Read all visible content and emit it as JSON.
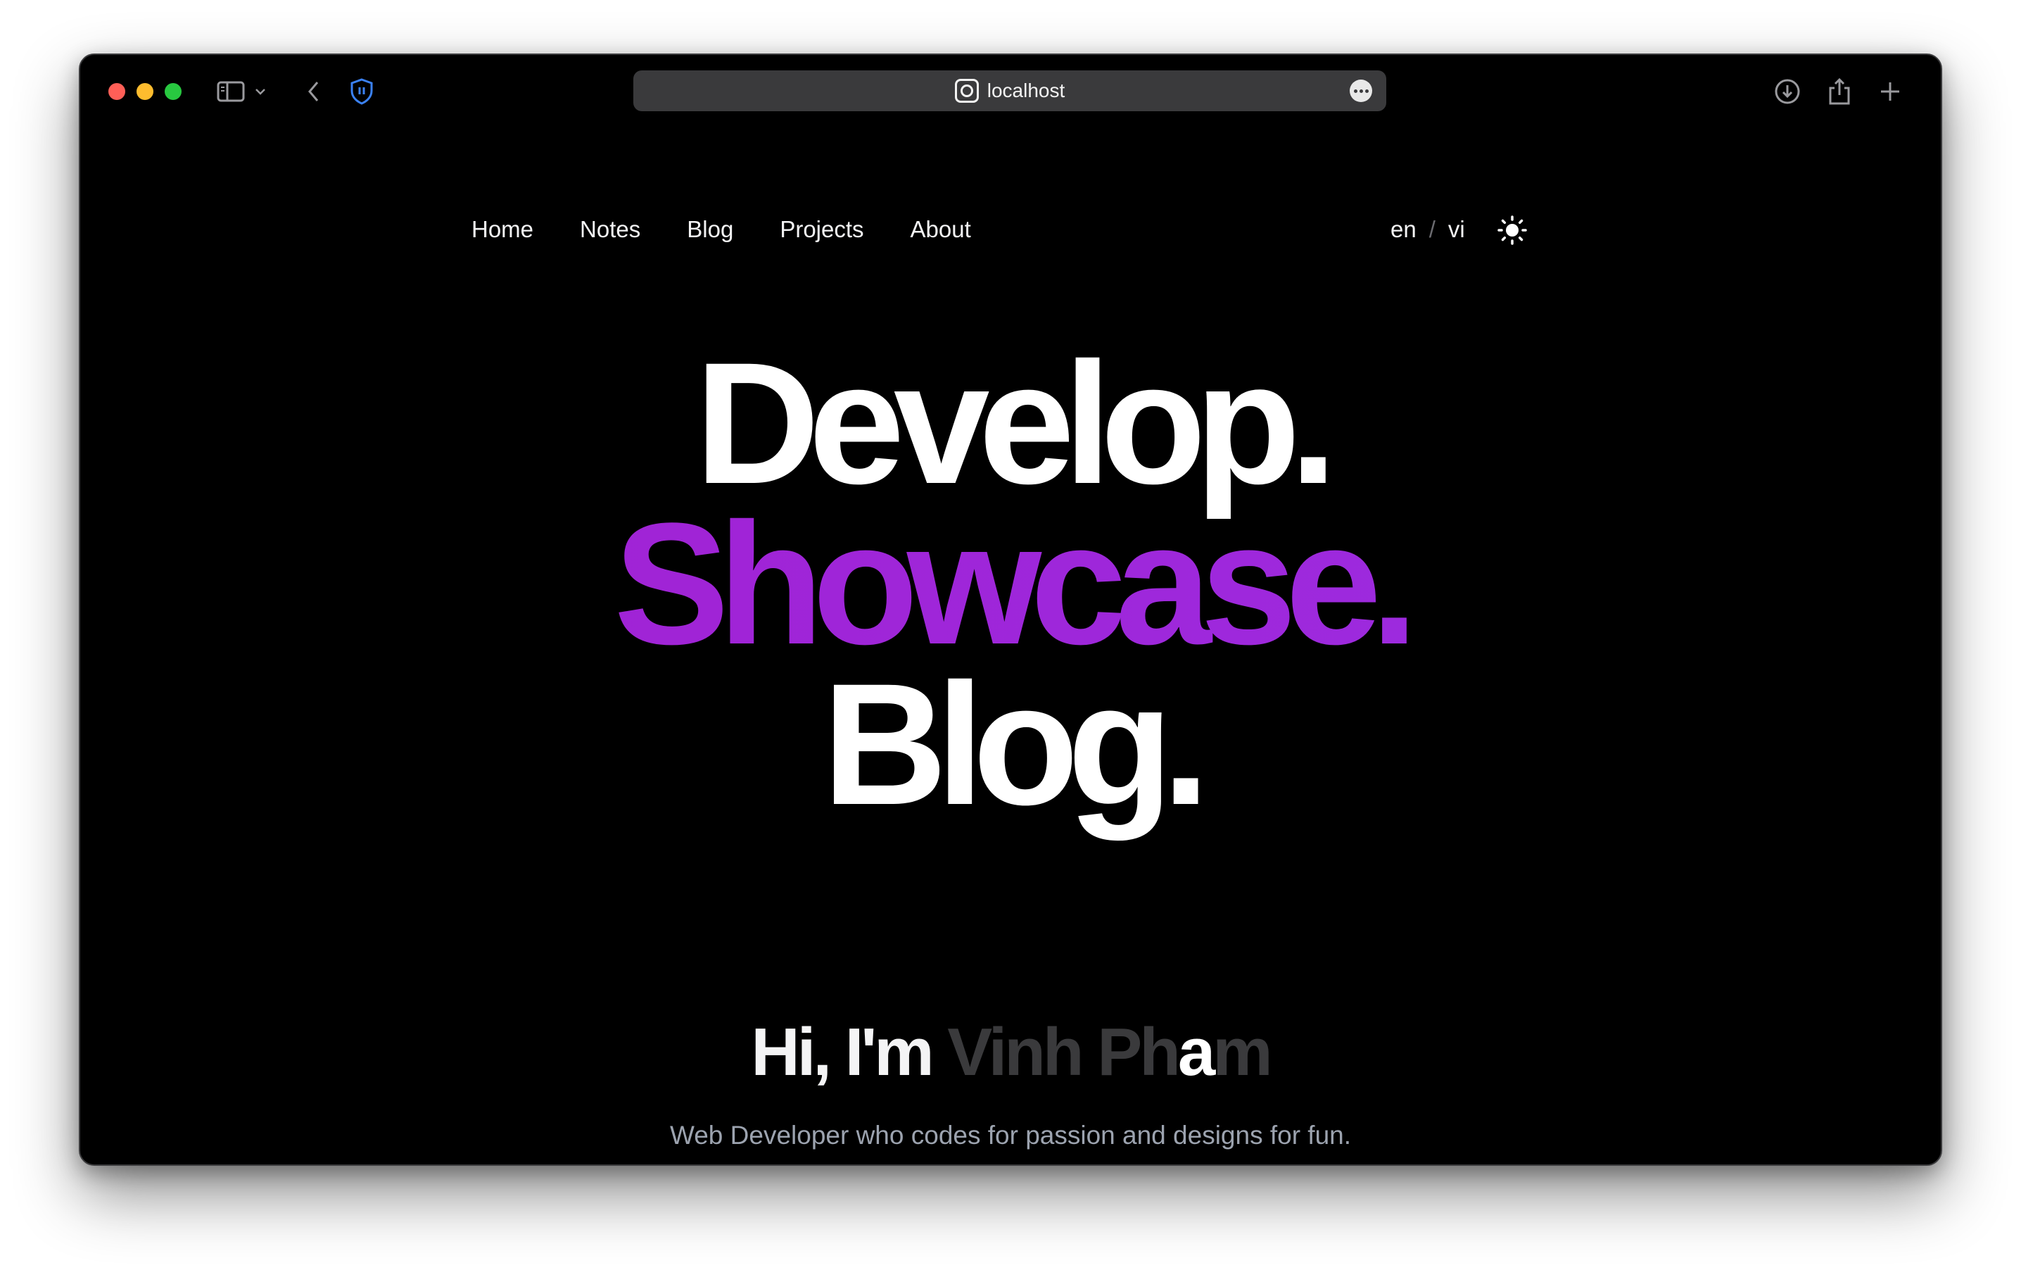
{
  "browser": {
    "url": "localhost"
  },
  "nav": {
    "links": [
      "Home",
      "Notes",
      "Blog",
      "Projects",
      "About"
    ],
    "lang_en": "en",
    "lang_sep": "/",
    "lang_vi": "vi"
  },
  "hero": {
    "line1": "Develop.",
    "line2": "Showcase.",
    "line3": "Blog.",
    "accent_color": "#a12ad6"
  },
  "intro": {
    "greeting": "Hi, I'm",
    "name_dim_1": "Vinh Ph",
    "name_highlight": "a",
    "name_dim_2": "m"
  },
  "tagline": "Web Developer who codes for passion and designs for fun."
}
